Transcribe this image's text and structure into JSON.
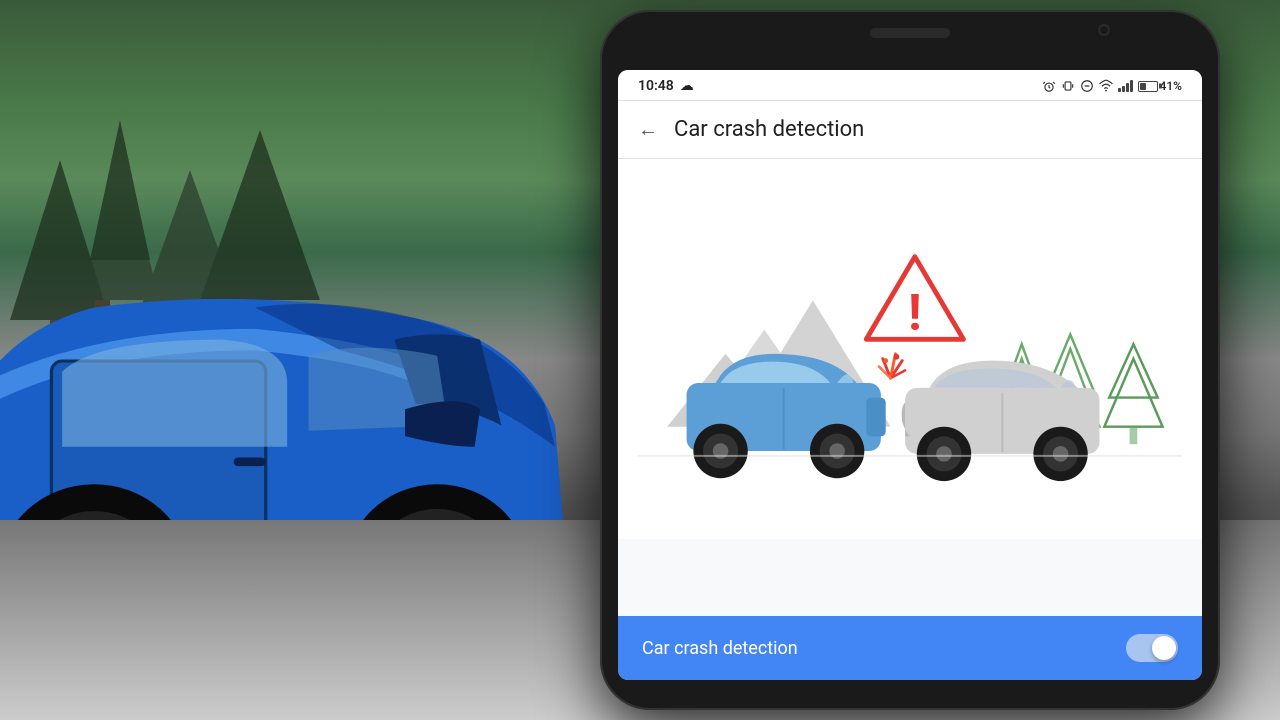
{
  "background": {
    "alt": "Crashed blue car background"
  },
  "phone": {
    "status_bar": {
      "time": "10:48",
      "weather_icon": "☁",
      "battery_percent": "41%",
      "icons": [
        "alarm-icon",
        "vibrate-icon",
        "minus-circle-icon",
        "wifi-icon",
        "signal-icon",
        "battery-icon"
      ]
    },
    "nav": {
      "back_label": "←",
      "title": "Car crash detection"
    },
    "illustration": {
      "alt": "Two cars colliding with warning triangle"
    },
    "bottom_toggle": {
      "label": "Car crash detection",
      "toggle_on": true
    }
  }
}
